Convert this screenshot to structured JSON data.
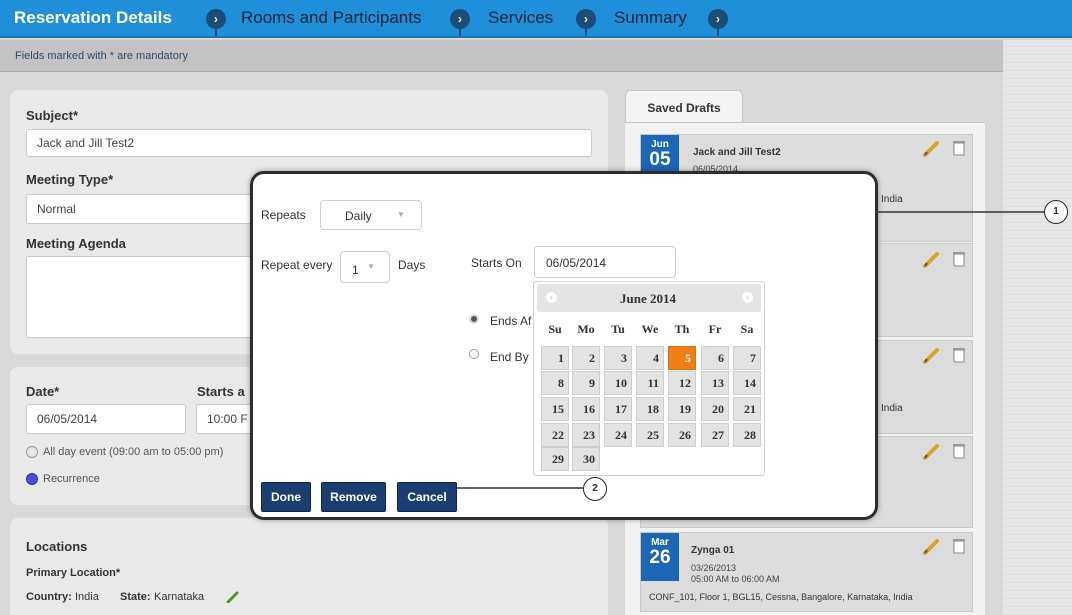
{
  "steps": [
    "Reservation Details",
    "Rooms and Participants",
    "Services",
    "Summary"
  ],
  "mandatory_note": "Fields marked with * are mandatory",
  "form": {
    "subject_label": "Subject*",
    "subject_value": "Jack and Jill Test2",
    "meeting_type_label": "Meeting Type*",
    "meeting_type_value": "Normal",
    "agenda_label": "Meeting Agenda",
    "date_label": "Date*",
    "date_value": "06/05/2014",
    "starts_label": "Starts a",
    "starts_value": "10:00 F",
    "allday_label": "All day event (09:00 am to 05:00 pm)",
    "recurrence_label": "Recurrence",
    "locations_label": "Locations",
    "primary_location_label": "Primary Location*",
    "country_label": "Country:",
    "country_value": "India",
    "state_label": "State:",
    "state_value": "Karnataka"
  },
  "drafts": {
    "tab_label": "Saved Drafts",
    "items": [
      {
        "month": "Jun",
        "day": "05",
        "title": "Jack and Jill Test2",
        "date": "06/05/2014",
        "line": "India"
      },
      {
        "line": ""
      },
      {
        "line": "India"
      },
      {
        "line": ""
      },
      {
        "month": "Mar",
        "day": "26",
        "title": "Zynga 01",
        "date": "03/26/2013",
        "time": "05:00 AM to 06:00 AM",
        "line": "CONF_101, Floor 1, BGL15, Cessna, Bangalore, Karnataka, India"
      }
    ]
  },
  "modal": {
    "repeats_label": "Repeats",
    "repeats_value": "Daily",
    "repeat_every_label": "Repeat every",
    "repeat_every_value": "1",
    "repeat_every_unit": "Days",
    "starts_on_label": "Starts On",
    "starts_on_value": "06/05/2014",
    "ends_after_label": "Ends Af",
    "end_by_label": "End By",
    "buttons": {
      "done": "Done",
      "remove": "Remove",
      "cancel": "Cancel"
    }
  },
  "calendar": {
    "title": "June 2014",
    "weekdays": [
      "Su",
      "Mo",
      "Tu",
      "We",
      "Th",
      "Fr",
      "Sa"
    ],
    "selected_day": "5",
    "rows": [
      [
        "",
        "",
        "",
        "",
        "",
        "",
        ""
      ],
      [
        "1",
        "2",
        "3",
        "4",
        "5",
        "6",
        "7"
      ],
      [
        "8",
        "9",
        "10",
        "11",
        "12",
        "13",
        "14"
      ],
      [
        "15",
        "16",
        "17",
        "18",
        "19",
        "20",
        "21"
      ],
      [
        "22",
        "23",
        "24",
        "25",
        "26",
        "27",
        "28"
      ],
      [
        "29",
        "30",
        "",
        "",
        "",
        "",
        ""
      ]
    ]
  },
  "callouts": [
    "1",
    "2"
  ],
  "colors": {
    "nav": "#1e8fd8",
    "accent": "#1b66b5",
    "selected": "#f07d15",
    "button": "#1b3e72"
  }
}
